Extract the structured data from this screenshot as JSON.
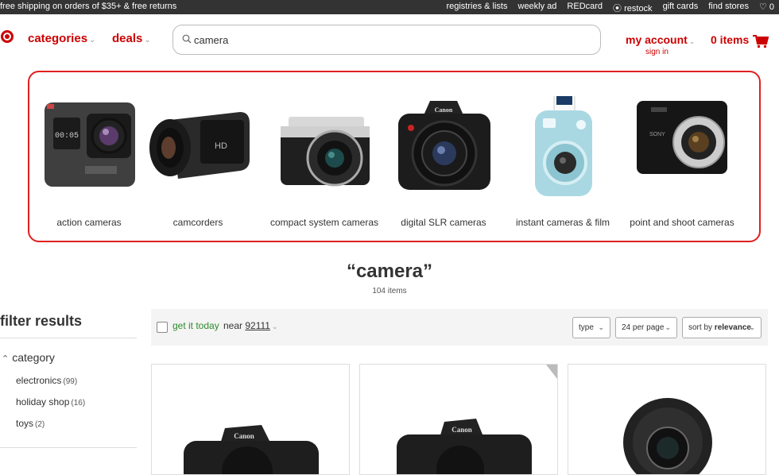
{
  "topbar": {
    "promo": "free shipping on orders of $35+ & free returns",
    "links": [
      "registries & lists",
      "weekly ad",
      "REDcard",
      "⦿ restock",
      "gift cards",
      "find stores",
      "♡ 0"
    ]
  },
  "header": {
    "categories_label": "categories",
    "deals_label": "deals",
    "search_value": "camera",
    "account_label": "my account",
    "signin_label": "sign in",
    "cart_label": "0 items"
  },
  "categories": [
    {
      "label": "action cameras",
      "icon": "action-camera"
    },
    {
      "label": "camcorders",
      "icon": "camcorder"
    },
    {
      "label": "compact system cameras",
      "icon": "compact-system-camera"
    },
    {
      "label": "digital SLR cameras",
      "icon": "dslr-camera"
    },
    {
      "label": "instant cameras & film",
      "icon": "instant-camera"
    },
    {
      "label": "point and shoot cameras",
      "icon": "point-and-shoot-camera"
    }
  ],
  "results": {
    "query": "“camera”",
    "count": "104 items"
  },
  "filters": {
    "title": "filter results",
    "facet": "category",
    "items": [
      {
        "label": "electronics",
        "count": "(99)"
      },
      {
        "label": "holiday shop",
        "count": "(16)"
      },
      {
        "label": "toys",
        "count": "(2)"
      }
    ]
  },
  "toolbar": {
    "get_it_today": "get it today",
    "near_label": "near",
    "zip": "92111",
    "type_label": "type",
    "per_page_label": "24 per page",
    "sort_prefix": "sort by",
    "sort_value": "relevance"
  },
  "products": [
    {
      "brand": "Canon"
    },
    {
      "brand": "Canon"
    },
    {
      "brand": ""
    }
  ],
  "colors": {
    "brand_red": "#cc0000",
    "panel_outline": "#e02020",
    "green": "#2e8b2e"
  }
}
